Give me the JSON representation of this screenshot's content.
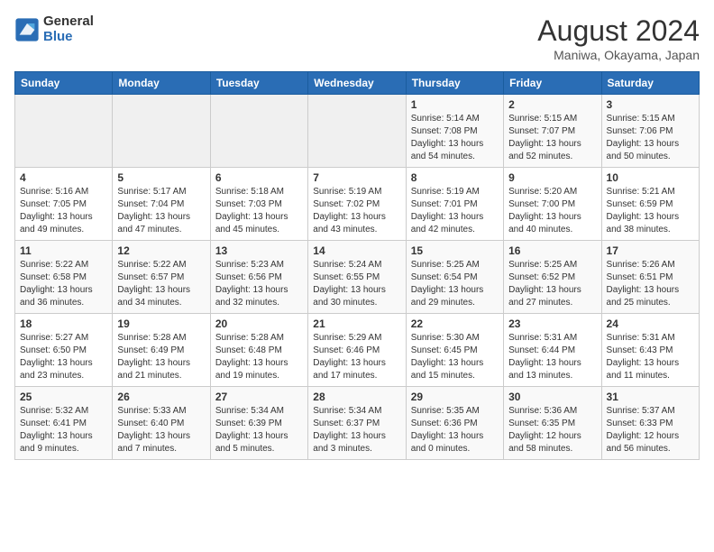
{
  "logo": {
    "general": "General",
    "blue": "Blue"
  },
  "title": "August 2024",
  "location": "Maniwa, Okayama, Japan",
  "days_of_week": [
    "Sunday",
    "Monday",
    "Tuesday",
    "Wednesday",
    "Thursday",
    "Friday",
    "Saturday"
  ],
  "weeks": [
    [
      {
        "day": "",
        "info": ""
      },
      {
        "day": "",
        "info": ""
      },
      {
        "day": "",
        "info": ""
      },
      {
        "day": "",
        "info": ""
      },
      {
        "day": "1",
        "info": "Sunrise: 5:14 AM\nSunset: 7:08 PM\nDaylight: 13 hours\nand 54 minutes."
      },
      {
        "day": "2",
        "info": "Sunrise: 5:15 AM\nSunset: 7:07 PM\nDaylight: 13 hours\nand 52 minutes."
      },
      {
        "day": "3",
        "info": "Sunrise: 5:15 AM\nSunset: 7:06 PM\nDaylight: 13 hours\nand 50 minutes."
      }
    ],
    [
      {
        "day": "4",
        "info": "Sunrise: 5:16 AM\nSunset: 7:05 PM\nDaylight: 13 hours\nand 49 minutes."
      },
      {
        "day": "5",
        "info": "Sunrise: 5:17 AM\nSunset: 7:04 PM\nDaylight: 13 hours\nand 47 minutes."
      },
      {
        "day": "6",
        "info": "Sunrise: 5:18 AM\nSunset: 7:03 PM\nDaylight: 13 hours\nand 45 minutes."
      },
      {
        "day": "7",
        "info": "Sunrise: 5:19 AM\nSunset: 7:02 PM\nDaylight: 13 hours\nand 43 minutes."
      },
      {
        "day": "8",
        "info": "Sunrise: 5:19 AM\nSunset: 7:01 PM\nDaylight: 13 hours\nand 42 minutes."
      },
      {
        "day": "9",
        "info": "Sunrise: 5:20 AM\nSunset: 7:00 PM\nDaylight: 13 hours\nand 40 minutes."
      },
      {
        "day": "10",
        "info": "Sunrise: 5:21 AM\nSunset: 6:59 PM\nDaylight: 13 hours\nand 38 minutes."
      }
    ],
    [
      {
        "day": "11",
        "info": "Sunrise: 5:22 AM\nSunset: 6:58 PM\nDaylight: 13 hours\nand 36 minutes."
      },
      {
        "day": "12",
        "info": "Sunrise: 5:22 AM\nSunset: 6:57 PM\nDaylight: 13 hours\nand 34 minutes."
      },
      {
        "day": "13",
        "info": "Sunrise: 5:23 AM\nSunset: 6:56 PM\nDaylight: 13 hours\nand 32 minutes."
      },
      {
        "day": "14",
        "info": "Sunrise: 5:24 AM\nSunset: 6:55 PM\nDaylight: 13 hours\nand 30 minutes."
      },
      {
        "day": "15",
        "info": "Sunrise: 5:25 AM\nSunset: 6:54 PM\nDaylight: 13 hours\nand 29 minutes."
      },
      {
        "day": "16",
        "info": "Sunrise: 5:25 AM\nSunset: 6:52 PM\nDaylight: 13 hours\nand 27 minutes."
      },
      {
        "day": "17",
        "info": "Sunrise: 5:26 AM\nSunset: 6:51 PM\nDaylight: 13 hours\nand 25 minutes."
      }
    ],
    [
      {
        "day": "18",
        "info": "Sunrise: 5:27 AM\nSunset: 6:50 PM\nDaylight: 13 hours\nand 23 minutes."
      },
      {
        "day": "19",
        "info": "Sunrise: 5:28 AM\nSunset: 6:49 PM\nDaylight: 13 hours\nand 21 minutes."
      },
      {
        "day": "20",
        "info": "Sunrise: 5:28 AM\nSunset: 6:48 PM\nDaylight: 13 hours\nand 19 minutes."
      },
      {
        "day": "21",
        "info": "Sunrise: 5:29 AM\nSunset: 6:46 PM\nDaylight: 13 hours\nand 17 minutes."
      },
      {
        "day": "22",
        "info": "Sunrise: 5:30 AM\nSunset: 6:45 PM\nDaylight: 13 hours\nand 15 minutes."
      },
      {
        "day": "23",
        "info": "Sunrise: 5:31 AM\nSunset: 6:44 PM\nDaylight: 13 hours\nand 13 minutes."
      },
      {
        "day": "24",
        "info": "Sunrise: 5:31 AM\nSunset: 6:43 PM\nDaylight: 13 hours\nand 11 minutes."
      }
    ],
    [
      {
        "day": "25",
        "info": "Sunrise: 5:32 AM\nSunset: 6:41 PM\nDaylight: 13 hours\nand 9 minutes."
      },
      {
        "day": "26",
        "info": "Sunrise: 5:33 AM\nSunset: 6:40 PM\nDaylight: 13 hours\nand 7 minutes."
      },
      {
        "day": "27",
        "info": "Sunrise: 5:34 AM\nSunset: 6:39 PM\nDaylight: 13 hours\nand 5 minutes."
      },
      {
        "day": "28",
        "info": "Sunrise: 5:34 AM\nSunset: 6:37 PM\nDaylight: 13 hours\nand 3 minutes."
      },
      {
        "day": "29",
        "info": "Sunrise: 5:35 AM\nSunset: 6:36 PM\nDaylight: 13 hours\nand 0 minutes."
      },
      {
        "day": "30",
        "info": "Sunrise: 5:36 AM\nSunset: 6:35 PM\nDaylight: 12 hours\nand 58 minutes."
      },
      {
        "day": "31",
        "info": "Sunrise: 5:37 AM\nSunset: 6:33 PM\nDaylight: 12 hours\nand 56 minutes."
      }
    ]
  ]
}
